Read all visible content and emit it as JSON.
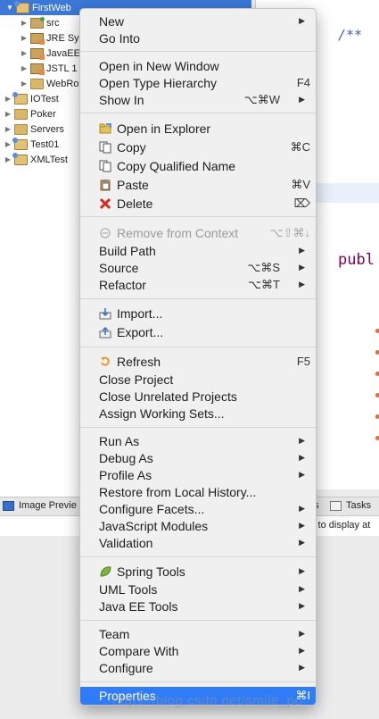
{
  "explorer": {
    "items": [
      {
        "label": "FirstWeb",
        "twisty": "▼"
      },
      {
        "label": "src",
        "twisty": "▶"
      },
      {
        "label": "JRE Sys",
        "twisty": "▶"
      },
      {
        "label": "JavaEE",
        "twisty": "▶"
      },
      {
        "label": "JSTL 1",
        "twisty": "▶"
      },
      {
        "label": "WebRoo",
        "twisty": "▶"
      },
      {
        "label": "IOTest",
        "twisty": "▶"
      },
      {
        "label": "Poker",
        "twisty": "▶"
      },
      {
        "label": "Servers",
        "twisty": "▶"
      },
      {
        "label": "Test01",
        "twisty": "▶"
      },
      {
        "label": "XMLTest",
        "twisty": "▶"
      }
    ]
  },
  "editor": {
    "comment": "/**",
    "keyword": "publ"
  },
  "panels": {
    "image_preview": "Image Previe",
    "tasks": "Tasks",
    "s_fragment": "s",
    "no_display": "s to display at"
  },
  "menu": {
    "items": [
      {
        "label": "New",
        "submenu": "▶"
      },
      {
        "label": "Go Into"
      },
      {
        "label": "Open in New Window"
      },
      {
        "label": "Open Type Hierarchy",
        "shortcut": "F4"
      },
      {
        "label": "Show In",
        "shortcut": "⌥⌘W",
        "submenu": "▶"
      },
      {
        "label": "Open in Explorer",
        "icon": "explorer-icon"
      },
      {
        "label": "Copy",
        "shortcut": "⌘C",
        "icon": "copy-icon"
      },
      {
        "label": "Copy Qualified Name",
        "icon": "copy-qualified-icon"
      },
      {
        "label": "Paste",
        "shortcut": "⌘V",
        "icon": "paste-icon"
      },
      {
        "label": "Delete",
        "shortcut": "⌦",
        "icon": "delete-icon"
      },
      {
        "label": "Remove from Context",
        "shortcut": "⌥⇧⌘↓",
        "icon": "remove-context-icon",
        "disabled": true
      },
      {
        "label": "Build Path",
        "submenu": "▶"
      },
      {
        "label": "Source",
        "shortcut": "⌥⌘S",
        "submenu": "▶"
      },
      {
        "label": "Refactor",
        "shortcut": "⌥⌘T",
        "submenu": "▶"
      },
      {
        "label": "Import...",
        "icon": "import-icon"
      },
      {
        "label": "Export...",
        "icon": "export-icon"
      },
      {
        "label": "Refresh",
        "shortcut": "F5",
        "icon": "refresh-icon"
      },
      {
        "label": "Close Project"
      },
      {
        "label": "Close Unrelated Projects"
      },
      {
        "label": "Assign Working Sets..."
      },
      {
        "label": "Run As",
        "submenu": "▶"
      },
      {
        "label": "Debug As",
        "submenu": "▶"
      },
      {
        "label": "Profile As",
        "submenu": "▶"
      },
      {
        "label": "Restore from Local History..."
      },
      {
        "label": "Configure Facets...",
        "submenu": "▶"
      },
      {
        "label": "JavaScript Modules",
        "submenu": "▶"
      },
      {
        "label": "Validation",
        "submenu": "▶"
      },
      {
        "label": "Spring Tools",
        "icon": "spring-leaf-icon",
        "submenu": "▶"
      },
      {
        "label": "UML Tools",
        "submenu": "▶"
      },
      {
        "label": "Java EE Tools",
        "submenu": "▶"
      },
      {
        "label": "Team",
        "submenu": "▶"
      },
      {
        "label": "Compare With",
        "submenu": "▶"
      },
      {
        "label": "Configure",
        "submenu": "▶"
      },
      {
        "label": "Properties",
        "shortcut": "⌘I",
        "highlighted": true
      }
    ]
  },
  "watermark": "https://blog.csdn.net/smile_po",
  "colors": {
    "selection": "#3b78d8",
    "menu_highlight": "#2f7cf6",
    "comment": "#3f5fbf",
    "keyword": "#7f0055"
  }
}
